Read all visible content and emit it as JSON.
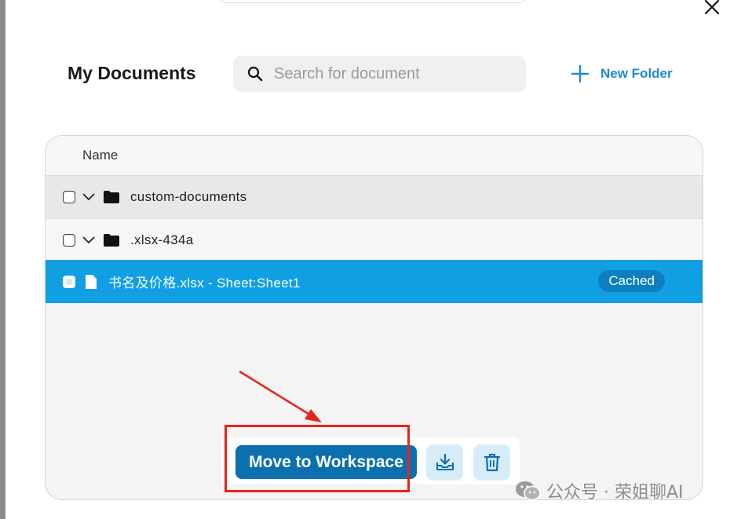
{
  "page": {
    "title": "My Documents"
  },
  "search": {
    "placeholder": "Search for document",
    "value": ""
  },
  "actions": {
    "new_folder_label": "New Folder"
  },
  "table": {
    "column_header": "Name",
    "rows": [
      {
        "type": "folder",
        "name": "custom-documents",
        "checked": false,
        "expanded": true
      },
      {
        "type": "folder",
        "name": ".xlsx-434a",
        "checked": false,
        "expanded": true
      },
      {
        "type": "file",
        "name": "书名及价格.xlsx - Sheet:Sheet1",
        "checked": true,
        "badge": "Cached",
        "selected": true
      }
    ]
  },
  "toolbar": {
    "move_label": "Move to Workspace"
  },
  "watermark": {
    "text": "公众号 · 荣姐聊AI"
  },
  "colors": {
    "accent": "#1e88d8",
    "selected_row": "#109fe3",
    "badge": "#0d7fc0",
    "move_button": "#0b70ad",
    "icon_button_bg": "#d7ecf9",
    "annotation": "#e8231b"
  },
  "icons": {
    "close": "close-icon",
    "search": "search-icon",
    "new_folder": "plus-icon",
    "chevron": "chevron-down-icon",
    "folder": "folder-icon",
    "file": "file-icon",
    "download": "download-to-tray-icon",
    "delete": "trash-icon",
    "watermark_logo": "wechat-icon"
  }
}
